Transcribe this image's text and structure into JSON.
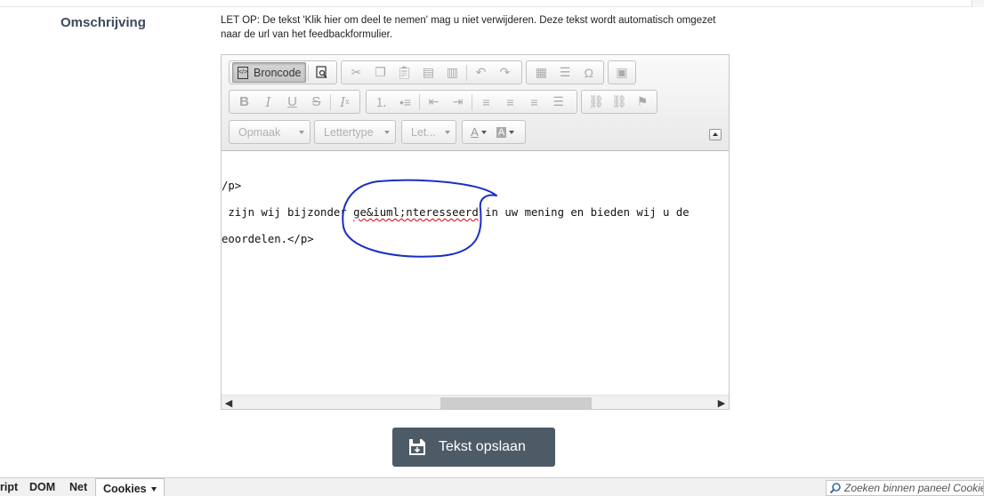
{
  "form": {
    "field_label": "Omschrijving",
    "note": "LET OP: De tekst 'Klik hier om deel te nemen' mag u niet verwijderen. Deze tekst wordt automatisch omgezet naar de url van het feedbackformulier."
  },
  "editor": {
    "toolbar": {
      "source_button": "Broncode",
      "format_combo": "Opmaak",
      "font_combo": "Lettertype",
      "size_combo": "Let..."
    },
    "source_lines": {
      "line1": "/p>",
      "line2_pre": " zijn wij bijzonder ",
      "line2_misspelled": "ge&iuml;nteresseerd",
      "line2_post": " in uw mening en bieden wij u de",
      "line3": "eoordelen.</p>"
    },
    "annotation_color": "#1a2fc4"
  },
  "actions": {
    "save_label": "Tekst opslaan"
  },
  "devtools": {
    "tabs": [
      "ript",
      "DOM",
      "Net",
      "Cookies"
    ],
    "search_placeholder": "Zoeken binnen paneel Cookies"
  }
}
